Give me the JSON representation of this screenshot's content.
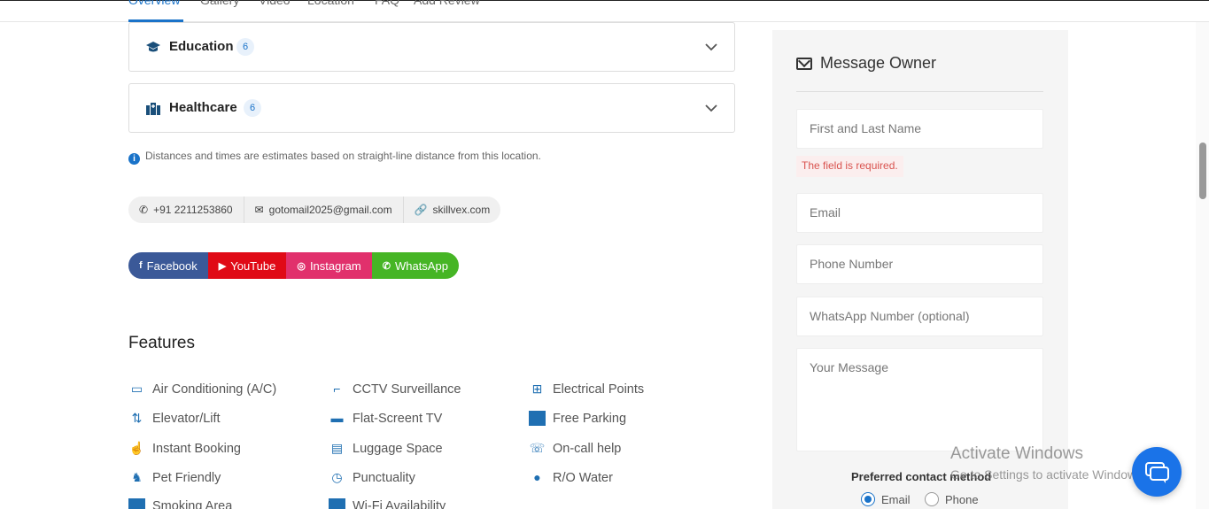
{
  "tabs": [
    {
      "label": "Overview"
    },
    {
      "label": "Gallery"
    },
    {
      "label": "Video"
    },
    {
      "label": "Location"
    },
    {
      "label": "FAQ"
    },
    {
      "label": "Add Review"
    }
  ],
  "accordions": [
    {
      "title": "Education",
      "count": "6",
      "icon": "graduation-cap-icon"
    },
    {
      "title": "Healthcare",
      "count": "6",
      "icon": "hospital-icon"
    }
  ],
  "note": "Distances and times are estimates based on straight-line distance from this location.",
  "contacts": {
    "phone": "+91 2211253860",
    "email": "gotomail2025@gmail.com",
    "website": "skillvex.com"
  },
  "socials": [
    {
      "label": "Facebook",
      "color": "#3b5998"
    },
    {
      "label": "YouTube",
      "color": "#e00a16"
    },
    {
      "label": "Instagram",
      "color": "#e1306c"
    },
    {
      "label": "WhatsApp",
      "color": "#46b525"
    }
  ],
  "features": {
    "title": "Features",
    "items": [
      {
        "label": "Air Conditioning (A/C)",
        "icon": "air-conditioner-icon"
      },
      {
        "label": "CCTV Surveillance",
        "icon": "cctv-icon"
      },
      {
        "label": "Electrical Points",
        "icon": "power-socket-icon"
      },
      {
        "label": "Elevator/Lift",
        "icon": "elevator-icon"
      },
      {
        "label": "Flat-Screent TV",
        "icon": "tv-icon"
      },
      {
        "label": "Free Parking",
        "icon": "parking-icon"
      },
      {
        "label": "Instant Booking",
        "icon": "hand-pointer-icon"
      },
      {
        "label": "Luggage Space",
        "icon": "luggage-icon"
      },
      {
        "label": "On-call help",
        "icon": "phone-help-icon"
      },
      {
        "label": "Pet Friendly",
        "icon": "pet-icon"
      },
      {
        "label": "Punctuality",
        "icon": "clock-icon"
      },
      {
        "label": "R/O Water",
        "icon": "water-icon"
      },
      {
        "label": "Smoking Area",
        "icon": "smoking-icon"
      },
      {
        "label": "Wi-Fi Availability",
        "icon": "wifi-icon"
      }
    ]
  },
  "form": {
    "title": "Message Owner",
    "name_placeholder": "First and Last Name",
    "name_error": "The field is required.",
    "email_placeholder": "Email",
    "phone_placeholder": "Phone Number",
    "whatsapp_placeholder": "WhatsApp Number (optional)",
    "message_placeholder": "Your Message",
    "preferred_label": "Preferred contact method",
    "option_email": "Email",
    "option_phone": "Phone",
    "selected": "Email"
  },
  "watermark": {
    "line1": "Activate Windows",
    "line2": "Go to Settings to activate Windows."
  },
  "accent_color": "#1a73c9"
}
